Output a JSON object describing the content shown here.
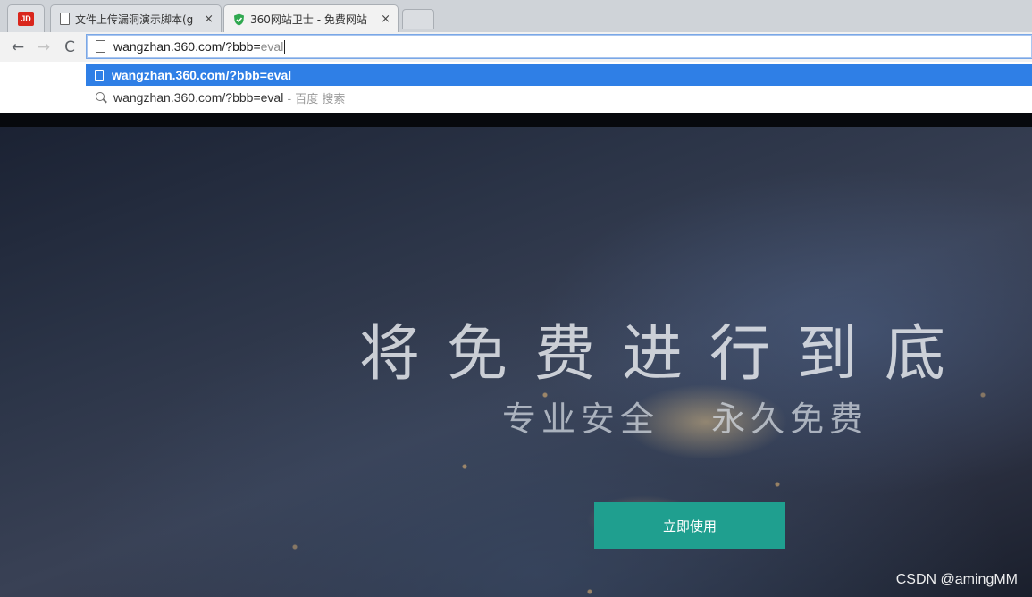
{
  "tabs": [
    {
      "icon": "jd-logo",
      "logo_text": "JD"
    },
    {
      "icon": "page-icon",
      "title": "文件上传漏洞演示脚本(g",
      "close": "×"
    },
    {
      "icon": "shield-icon",
      "title": "360网站卫士 - 免费网站",
      "close": "×"
    }
  ],
  "toolbar": {
    "back_icon": "←",
    "forward_icon": "→",
    "reload_icon": "C"
  },
  "omnibox": {
    "typed": "wangzhan.360.com/?bbb=",
    "completion": "eval"
  },
  "suggestions": [
    {
      "icon": "page-icon",
      "text": "wangzhan.360.com/?bbb=eval"
    },
    {
      "icon": "search-icon",
      "text": "wangzhan.360.com/?bbb=eval",
      "engine": "- 百度 搜索"
    }
  ],
  "hero": {
    "headline": "将免费进行到底",
    "sub_left": "专业安全",
    "sub_right": "永久免费",
    "cta_label": "立即使用"
  },
  "watermark": "CSDN @amingMM",
  "colors": {
    "accent": "#1f9f8f",
    "suggestion_highlight": "#2f7fe6"
  }
}
